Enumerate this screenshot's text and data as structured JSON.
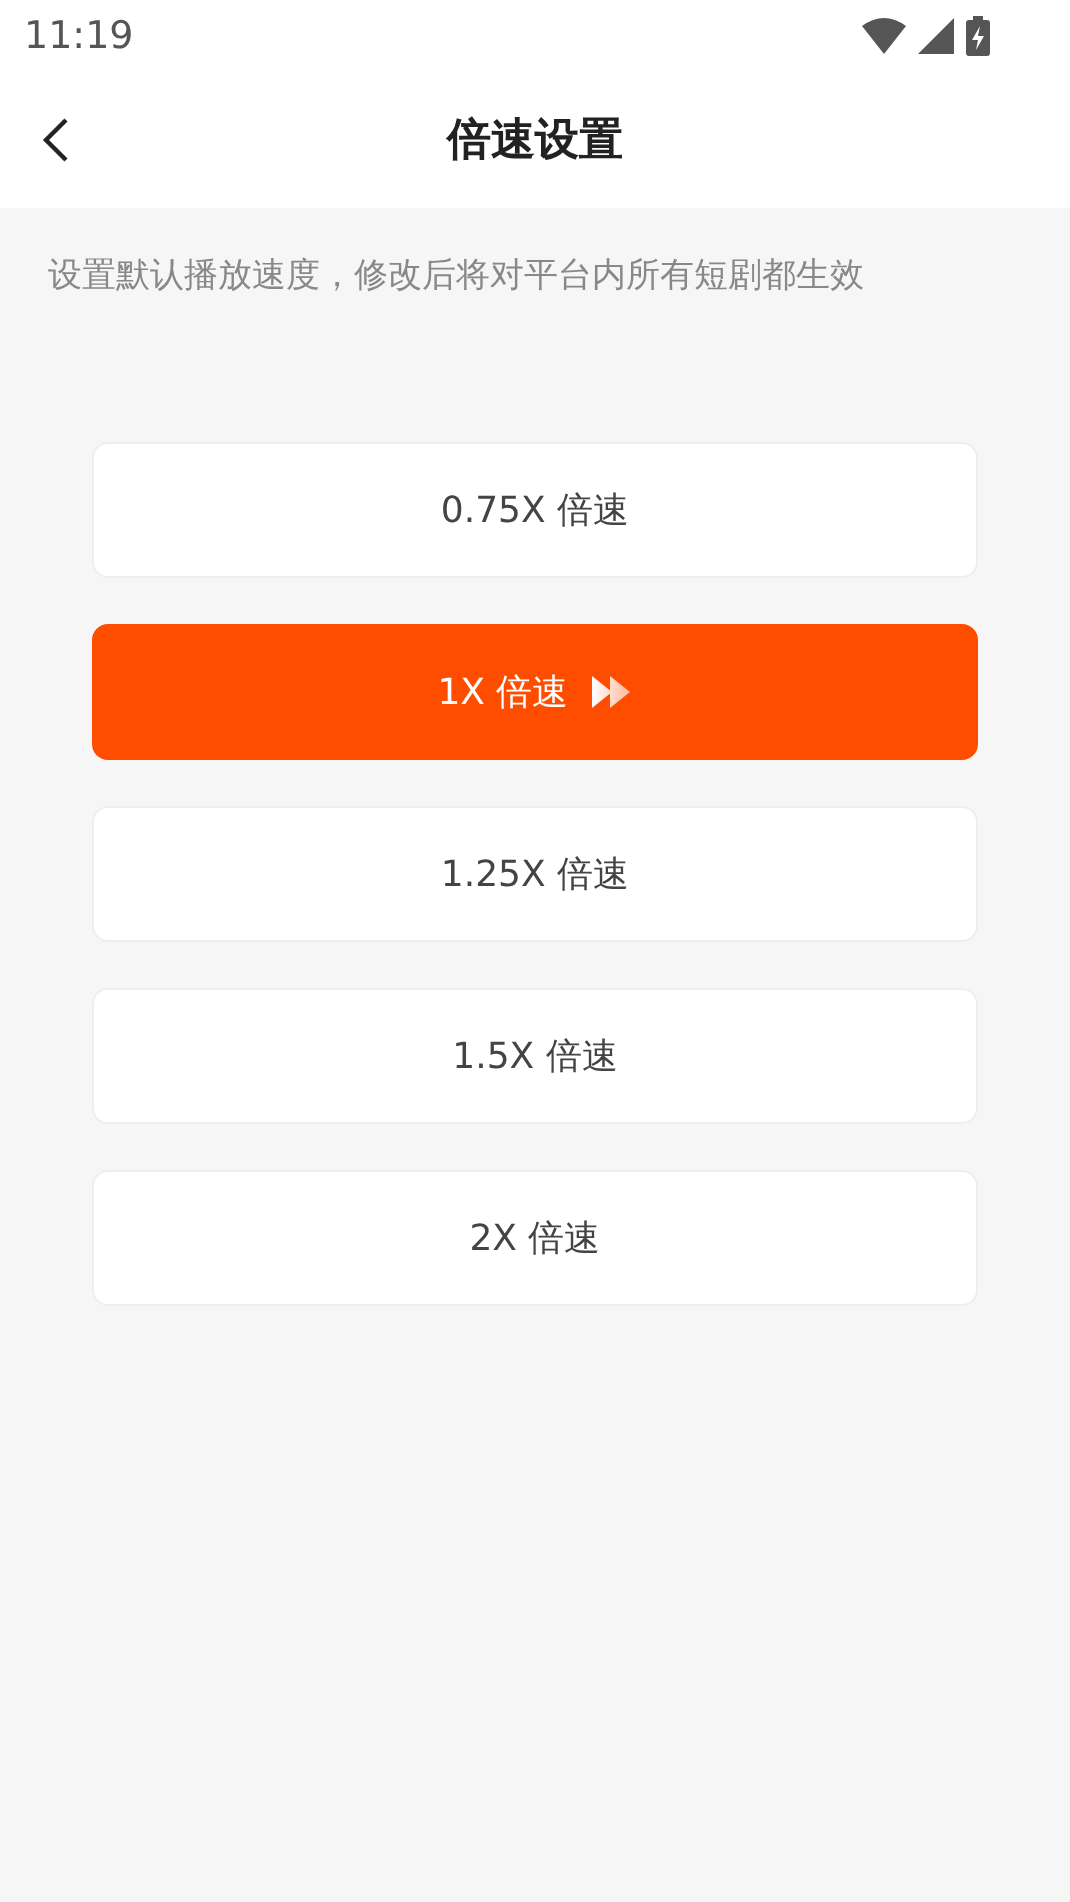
{
  "status_bar": {
    "time": "11:19"
  },
  "header": {
    "title": "倍速设置"
  },
  "description": "设置默认播放速度，修改后将对平台内所有短剧都生效",
  "options": [
    {
      "label": "0.75X 倍速",
      "selected": false
    },
    {
      "label": "1X 倍速",
      "selected": true
    },
    {
      "label": "1.25X 倍速",
      "selected": false
    },
    {
      "label": "1.5X 倍速",
      "selected": false
    },
    {
      "label": "2X 倍速",
      "selected": false
    }
  ]
}
